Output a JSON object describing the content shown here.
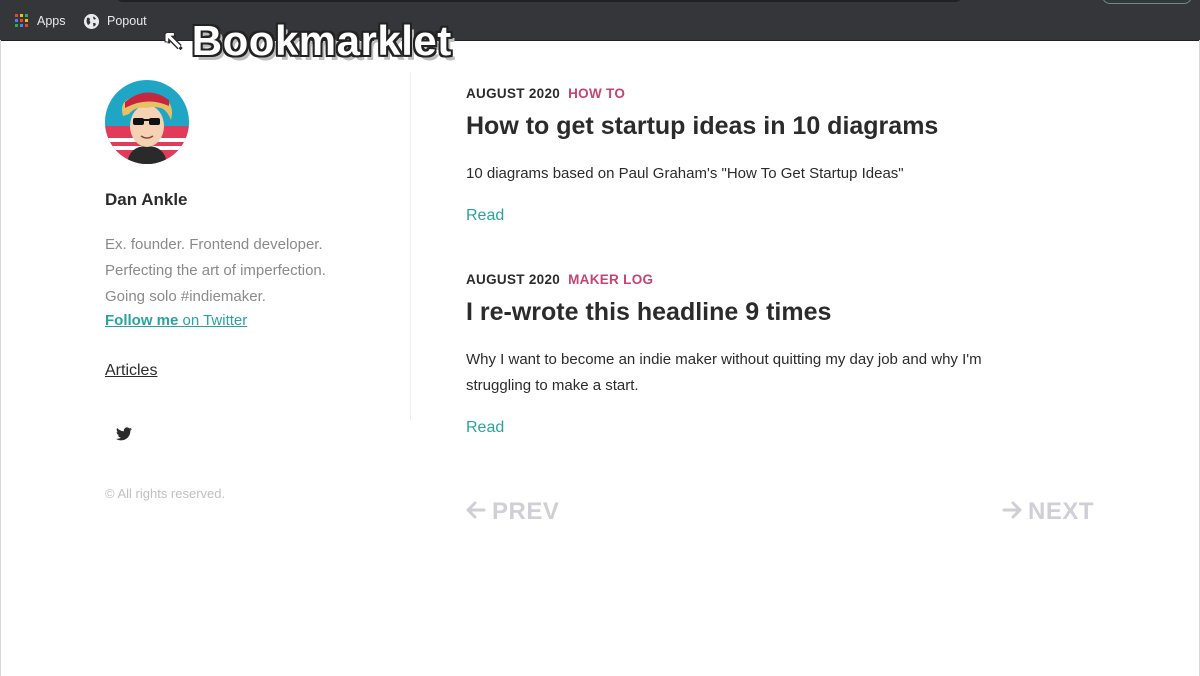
{
  "browser": {
    "bookmarks": [
      {
        "label": "Apps",
        "icon": "apps-grid-icon"
      },
      {
        "label": "Popout",
        "icon": "globe-icon"
      }
    ]
  },
  "overlay": {
    "caption": "Bookmarklet",
    "cursor_glyph": "↖"
  },
  "sidebar": {
    "author_name": "Dan Ankle",
    "bio_lines": [
      "Ex. founder. Frontend developer.",
      "Perfecting the art of imperfection.",
      "Going solo #indiemaker."
    ],
    "follow": {
      "strong": "Follow me",
      "rest": " on Twitter"
    },
    "articles_label": "Articles",
    "social_icon": "twitter-icon",
    "copyright": "© All rights reserved."
  },
  "posts": [
    {
      "date": "AUGUST 2020",
      "tag": "HOW TO",
      "title": "How to get startup ideas in 10 diagrams",
      "excerpt": "10 diagrams based on Paul Graham's \"How To Get Startup Ideas\"",
      "read_label": "Read"
    },
    {
      "date": "AUGUST 2020",
      "tag": "MAKER LOG",
      "title": "I re-wrote this headline 9 times",
      "excerpt": "Why I want to become an indie maker without quitting my day job and why I'm struggling to make a start.",
      "read_label": "Read"
    }
  ],
  "pagination": {
    "prev_label": "PREV",
    "next_label": "NEXT"
  },
  "colors": {
    "accent_teal": "#2aa3a0",
    "tag_pink": "#c4456e",
    "bookmarks_bar": "#35363a",
    "pager_gray": "#cfcfd6"
  }
}
